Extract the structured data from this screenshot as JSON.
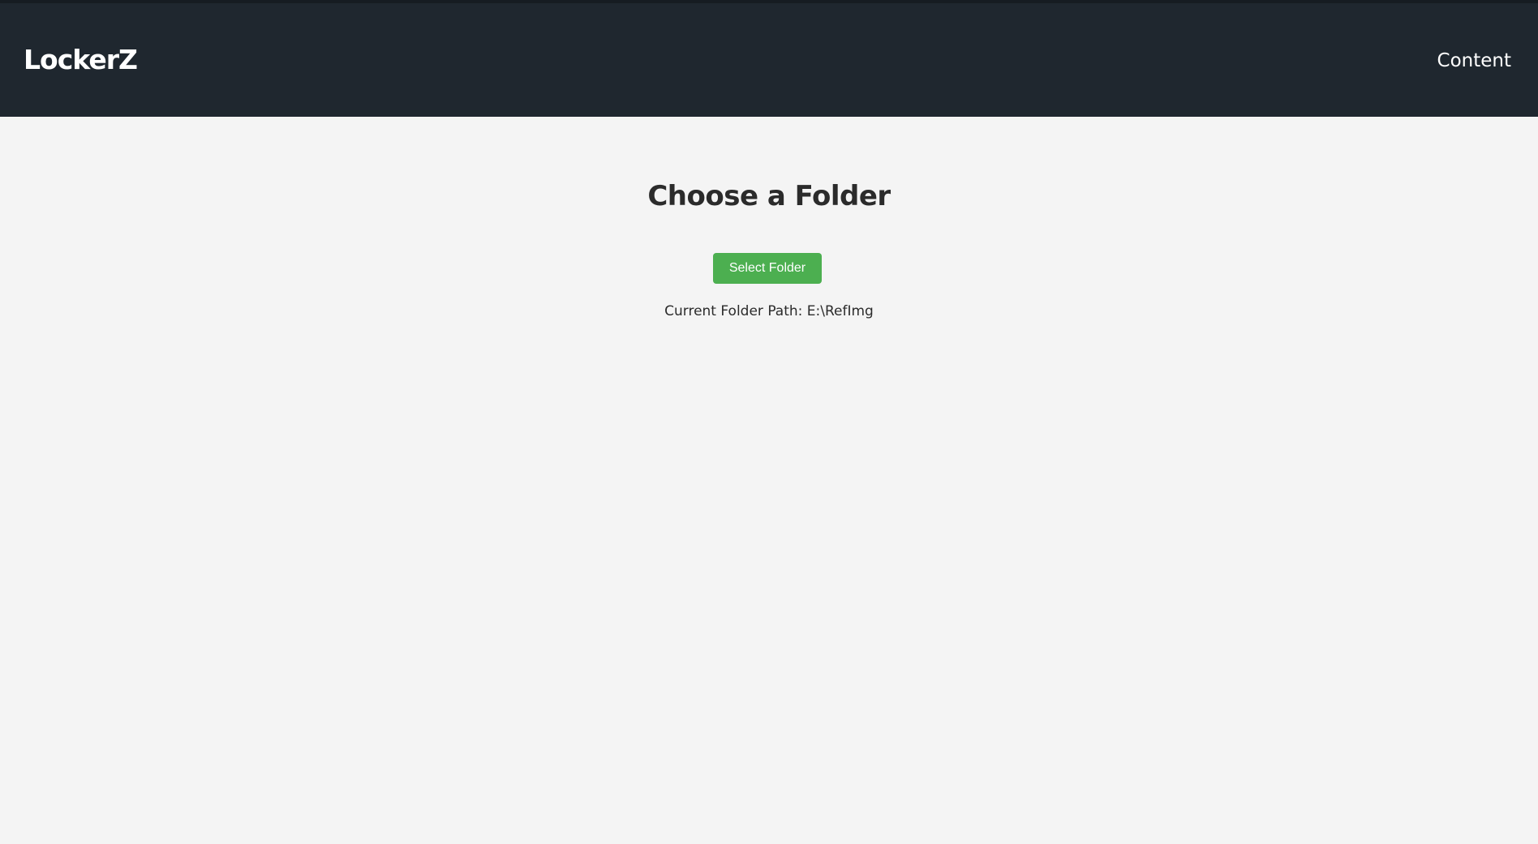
{
  "header": {
    "brand": "LockerZ",
    "nav_link": "Content"
  },
  "main": {
    "title": "Choose a Folder",
    "select_button_label": "Select Folder",
    "current_path_label": "Current Folder Path:",
    "current_path_value": "E:\\RefImg"
  },
  "colors": {
    "header_bg": "#1f272f",
    "page_bg": "#f4f4f4",
    "button_green": "#4caf50",
    "text_dark": "#2b2b2b"
  }
}
